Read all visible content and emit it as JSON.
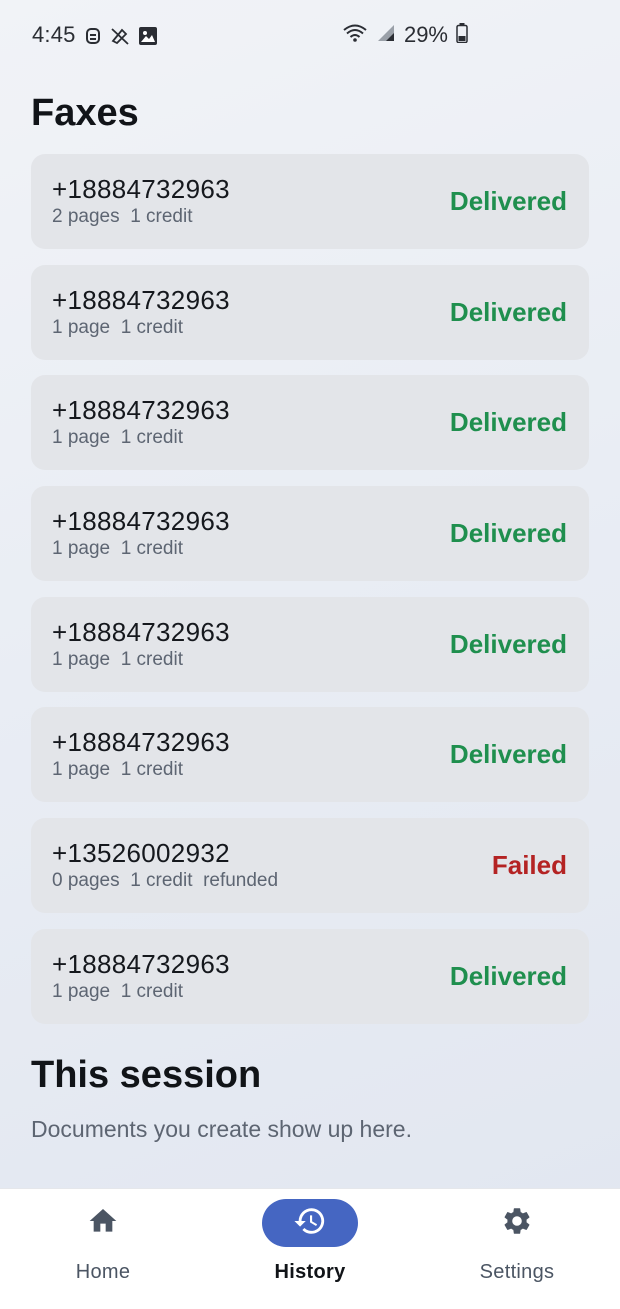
{
  "status_bar": {
    "time": "4:45",
    "battery": "29%"
  },
  "page": {
    "title": "Faxes"
  },
  "faxes": [
    {
      "number": "+18884732963",
      "pages": "2 pages",
      "credit": "1 credit",
      "extra": "",
      "status": "Delivered"
    },
    {
      "number": "+18884732963",
      "pages": "1 page",
      "credit": "1 credit",
      "extra": "",
      "status": "Delivered"
    },
    {
      "number": "+18884732963",
      "pages": "1 page",
      "credit": "1 credit",
      "extra": "",
      "status": "Delivered"
    },
    {
      "number": "+18884732963",
      "pages": "1 page",
      "credit": "1 credit",
      "extra": "",
      "status": "Delivered"
    },
    {
      "number": "+18884732963",
      "pages": "1 page",
      "credit": "1 credit",
      "extra": "",
      "status": "Delivered"
    },
    {
      "number": "+18884732963",
      "pages": "1 page",
      "credit": "1 credit",
      "extra": "",
      "status": "Delivered"
    },
    {
      "number": "+13526002932",
      "pages": "0 pages",
      "credit": "1 credit",
      "extra": "refunded",
      "status": "Failed"
    },
    {
      "number": "+18884732963",
      "pages": "1 page",
      "credit": "1 credit",
      "extra": "",
      "status": "Delivered"
    }
  ],
  "status_colors": {
    "Delivered": "#1f8f4e",
    "Failed": "#b42323"
  },
  "session": {
    "title": "This session",
    "empty_text": "Documents you create show up here."
  },
  "nav": {
    "items": [
      {
        "label": "Home",
        "icon": "home-icon"
      },
      {
        "label": "History",
        "icon": "history-icon",
        "active": true
      },
      {
        "label": "Settings",
        "icon": "gear-icon"
      }
    ]
  }
}
